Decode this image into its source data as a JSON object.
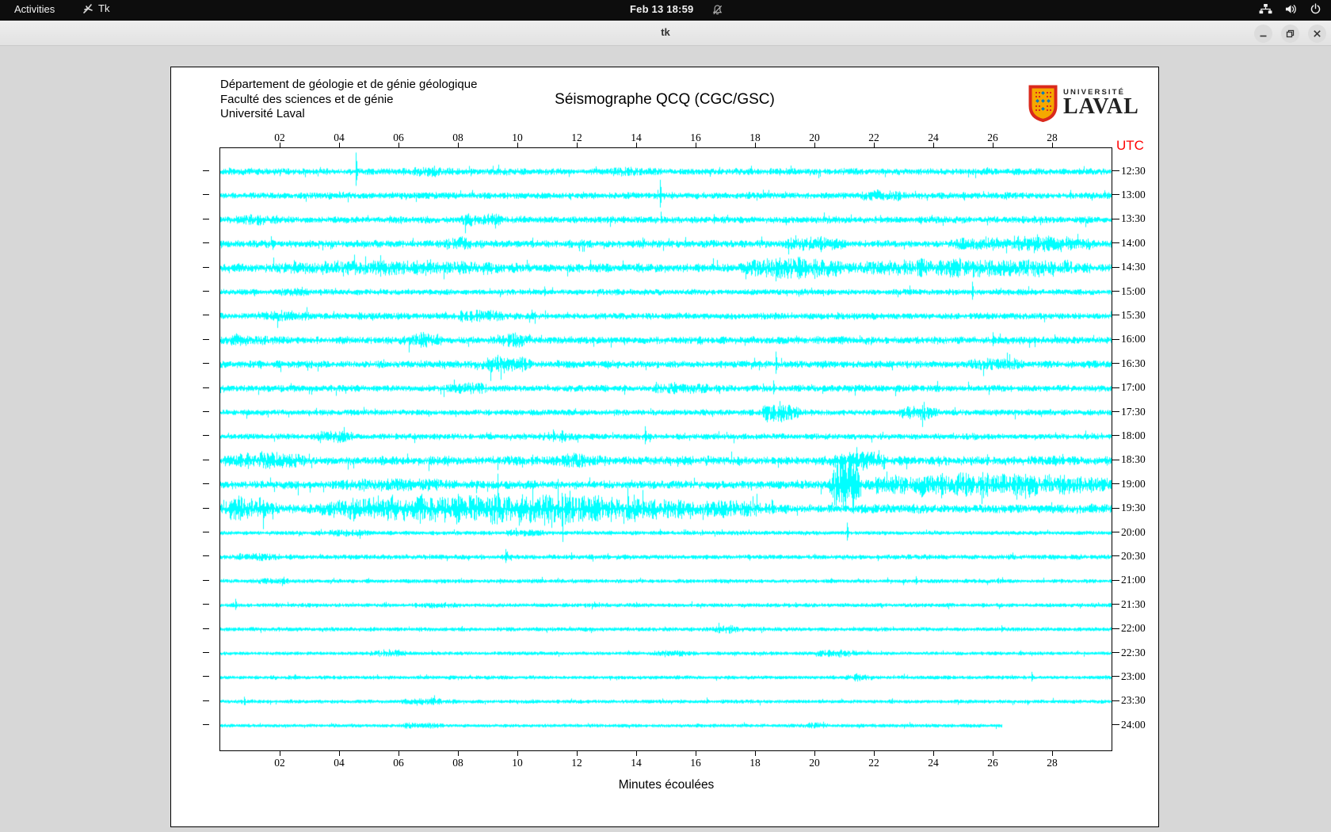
{
  "topbar": {
    "activities_label": "Activities",
    "app_name": "Tk",
    "clock": "Feb 13 18:59",
    "icons": [
      "tk-icon",
      "notifications-off-icon",
      "network-icon",
      "volume-icon",
      "power-icon"
    ]
  },
  "window": {
    "title": "tk",
    "controls": [
      "minimize",
      "restore",
      "close"
    ]
  },
  "canvas": {
    "header_lines": [
      "Département de géologie et de génie géologique",
      "Faculté des sciences et de génie",
      "Université Laval"
    ],
    "title": "Séismographe QCQ (CGC/GSC)",
    "logo": {
      "line1": "UNIVERSITÉ",
      "line2": "LAVAL"
    },
    "utc_label": "UTC",
    "xlabel": "Minutes écoulées"
  },
  "chart_data": {
    "type": "line",
    "subtype": "helicorder-seismogram",
    "title": "Séismographe QCQ (CGC/GSC)",
    "station": "QCQ (CGC/GSC)",
    "xlabel": "Minutes écoulées",
    "x_range_minutes": [
      0,
      30
    ],
    "x_tick_step_minutes": 2,
    "x_ticks": [
      "02",
      "04",
      "06",
      "08",
      "10",
      "12",
      "14",
      "16",
      "18",
      "20",
      "22",
      "24",
      "26",
      "28"
    ],
    "trace_color": "#00ffff",
    "utc_color": "#ff0000",
    "axis_color": "#000000",
    "minutes_per_row": 30,
    "rows": [
      {
        "time": "12:30",
        "amp": 3.2,
        "bursts": [
          [
            6,
            8,
            2
          ],
          [
            13,
            15,
            2
          ]
        ],
        "spikes": [
          [
            4.56,
            24
          ],
          [
            0.3,
            5
          ]
        ],
        "end": 30
      },
      {
        "time": "13:00",
        "amp": 3.2,
        "bursts": [
          [
            21.5,
            23,
            3
          ]
        ],
        "spikes": [
          [
            14.8,
            20
          ]
        ],
        "end": 30
      },
      {
        "time": "13:30",
        "amp": 3.4,
        "bursts": [
          [
            0.5,
            2,
            3
          ],
          [
            8,
            9.5,
            4
          ]
        ],
        "spikes": [
          [
            16.6,
            7
          ]
        ],
        "end": 30
      },
      {
        "time": "14:00",
        "amp": 3.6,
        "bursts": [
          [
            7.5,
            8.5,
            3
          ],
          [
            19,
            21,
            4
          ],
          [
            24.5,
            29.5,
            5
          ]
        ],
        "spikes": [
          [
            14.2,
            8
          ],
          [
            27.5,
            12
          ]
        ],
        "end": 30
      },
      {
        "time": "14:30",
        "amp": 4.2,
        "bursts": [
          [
            1.5,
            10,
            4
          ],
          [
            17.5,
            21,
            8
          ],
          [
            21,
            29.5,
            6
          ]
        ],
        "spikes": [
          [
            19.5,
            14
          ]
        ],
        "end": 30
      },
      {
        "time": "15:00",
        "amp": 2.8,
        "bursts": [
          [
            2,
            3,
            2
          ]
        ],
        "spikes": [
          [
            10.9,
            7
          ],
          [
            25.3,
            13
          ]
        ],
        "end": 30
      },
      {
        "time": "15:30",
        "amp": 3.2,
        "bursts": [
          [
            1.5,
            3,
            3
          ],
          [
            8,
            9.5,
            4
          ]
        ],
        "spikes": [
          [
            8.6,
            8
          ]
        ],
        "end": 30
      },
      {
        "time": "16:00",
        "amp": 3.6,
        "bursts": [
          [
            0,
            2,
            3
          ],
          [
            6,
            7.5,
            4
          ],
          [
            9,
            10.5,
            4
          ]
        ],
        "spikes": [
          [
            26,
            10
          ]
        ],
        "end": 30
      },
      {
        "time": "16:30",
        "amp": 3.6,
        "bursts": [
          [
            8.5,
            10.5,
            5
          ],
          [
            25,
            27,
            4
          ]
        ],
        "spikes": [
          [
            9.3,
            9
          ],
          [
            18.7,
            16
          ]
        ],
        "end": 30
      },
      {
        "time": "17:00",
        "amp": 3.2,
        "bursts": [
          [
            7.5,
            9,
            4
          ],
          [
            14.5,
            16.5,
            3
          ]
        ],
        "spikes": [
          [
            18.6,
            10
          ]
        ],
        "end": 30
      },
      {
        "time": "17:30",
        "amp": 2.8,
        "bursts": [
          [
            18.2,
            19.5,
            10
          ],
          [
            22.8,
            24.2,
            6
          ]
        ],
        "spikes": [
          [
            5.2,
            5
          ]
        ],
        "end": 30
      },
      {
        "time": "18:00",
        "amp": 2.8,
        "bursts": [
          [
            3,
            4.5,
            4
          ],
          [
            10.8,
            12,
            4
          ]
        ],
        "spikes": [
          [
            11.2,
            9
          ],
          [
            14.3,
            13
          ]
        ],
        "end": 30
      },
      {
        "time": "18:30",
        "amp": 4.5,
        "bursts": [
          [
            0,
            3,
            4
          ],
          [
            11,
            13,
            3
          ],
          [
            20.5,
            22.5,
            6
          ]
        ],
        "spikes": [
          [
            21.4,
            17
          ],
          [
            25.8,
            8
          ]
        ],
        "end": 30
      },
      {
        "time": "19:00",
        "amp": 4.2,
        "bursts": [
          [
            4,
            8,
            3
          ],
          [
            20.5,
            21.6,
            30
          ],
          [
            21.6,
            30,
            9
          ]
        ],
        "spikes": [
          [
            20.95,
            34
          ]
        ],
        "end": 30
      },
      {
        "time": "19:30",
        "amp": 4.5,
        "bursts": [
          [
            0,
            1.8,
            9
          ],
          [
            3.2,
            16,
            13
          ],
          [
            16,
            18.5,
            5
          ]
        ],
        "spikes": [
          [
            0.5,
            12
          ]
        ],
        "end": 30
      },
      {
        "time": "20:00",
        "amp": 1.8,
        "bursts": [
          [
            3.5,
            5,
            2
          ],
          [
            9.5,
            11,
            2
          ]
        ],
        "spikes": [
          [
            16.2,
            4
          ],
          [
            21.1,
            13
          ]
        ],
        "end": 30
      },
      {
        "time": "20:30",
        "amp": 2.2,
        "bursts": [
          [
            0.5,
            2,
            2
          ]
        ],
        "spikes": [
          [
            9.6,
            10
          ],
          [
            20,
            4
          ]
        ],
        "end": 30
      },
      {
        "time": "21:00",
        "amp": 1.8,
        "bursts": [
          [
            1,
            2.5,
            1.5
          ]
        ],
        "spikes": [
          [
            23.4,
            6
          ]
        ],
        "end": 30
      },
      {
        "time": "21:30",
        "amp": 1.8,
        "bursts": [
          [
            6.5,
            8,
            1.5
          ]
        ],
        "spikes": [
          [
            0.5,
            8
          ],
          [
            14,
            4
          ]
        ],
        "end": 30
      },
      {
        "time": "22:00",
        "amp": 1.8,
        "bursts": [
          [
            16.5,
            17.5,
            2.5
          ]
        ],
        "spikes": [
          [
            26.3,
            5
          ]
        ],
        "end": 30
      },
      {
        "time": "22:30",
        "amp": 1.6,
        "bursts": [
          [
            5,
            6.5,
            2
          ],
          [
            14.5,
            16,
            2
          ],
          [
            20,
            21.5,
            2
          ]
        ],
        "spikes": [
          [
            5.5,
            5
          ]
        ],
        "end": 30
      },
      {
        "time": "23:00",
        "amp": 1.6,
        "bursts": [
          [
            21,
            22,
            2
          ]
        ],
        "spikes": [
          [
            2.5,
            4
          ],
          [
            27.3,
            7
          ]
        ],
        "end": 30
      },
      {
        "time": "23:30",
        "amp": 1.6,
        "bursts": [
          [
            6,
            8,
            2
          ]
        ],
        "spikes": [
          [
            0.8,
            6
          ],
          [
            7.1,
            5
          ]
        ],
        "end": 30
      },
      {
        "time": "24:00",
        "amp": 1.5,
        "bursts": [
          [
            6,
            7.5,
            1.5
          ],
          [
            19.5,
            20.5,
            1.5
          ]
        ],
        "spikes": [
          [
            19.8,
            4
          ]
        ],
        "end": 26.3
      }
    ]
  }
}
